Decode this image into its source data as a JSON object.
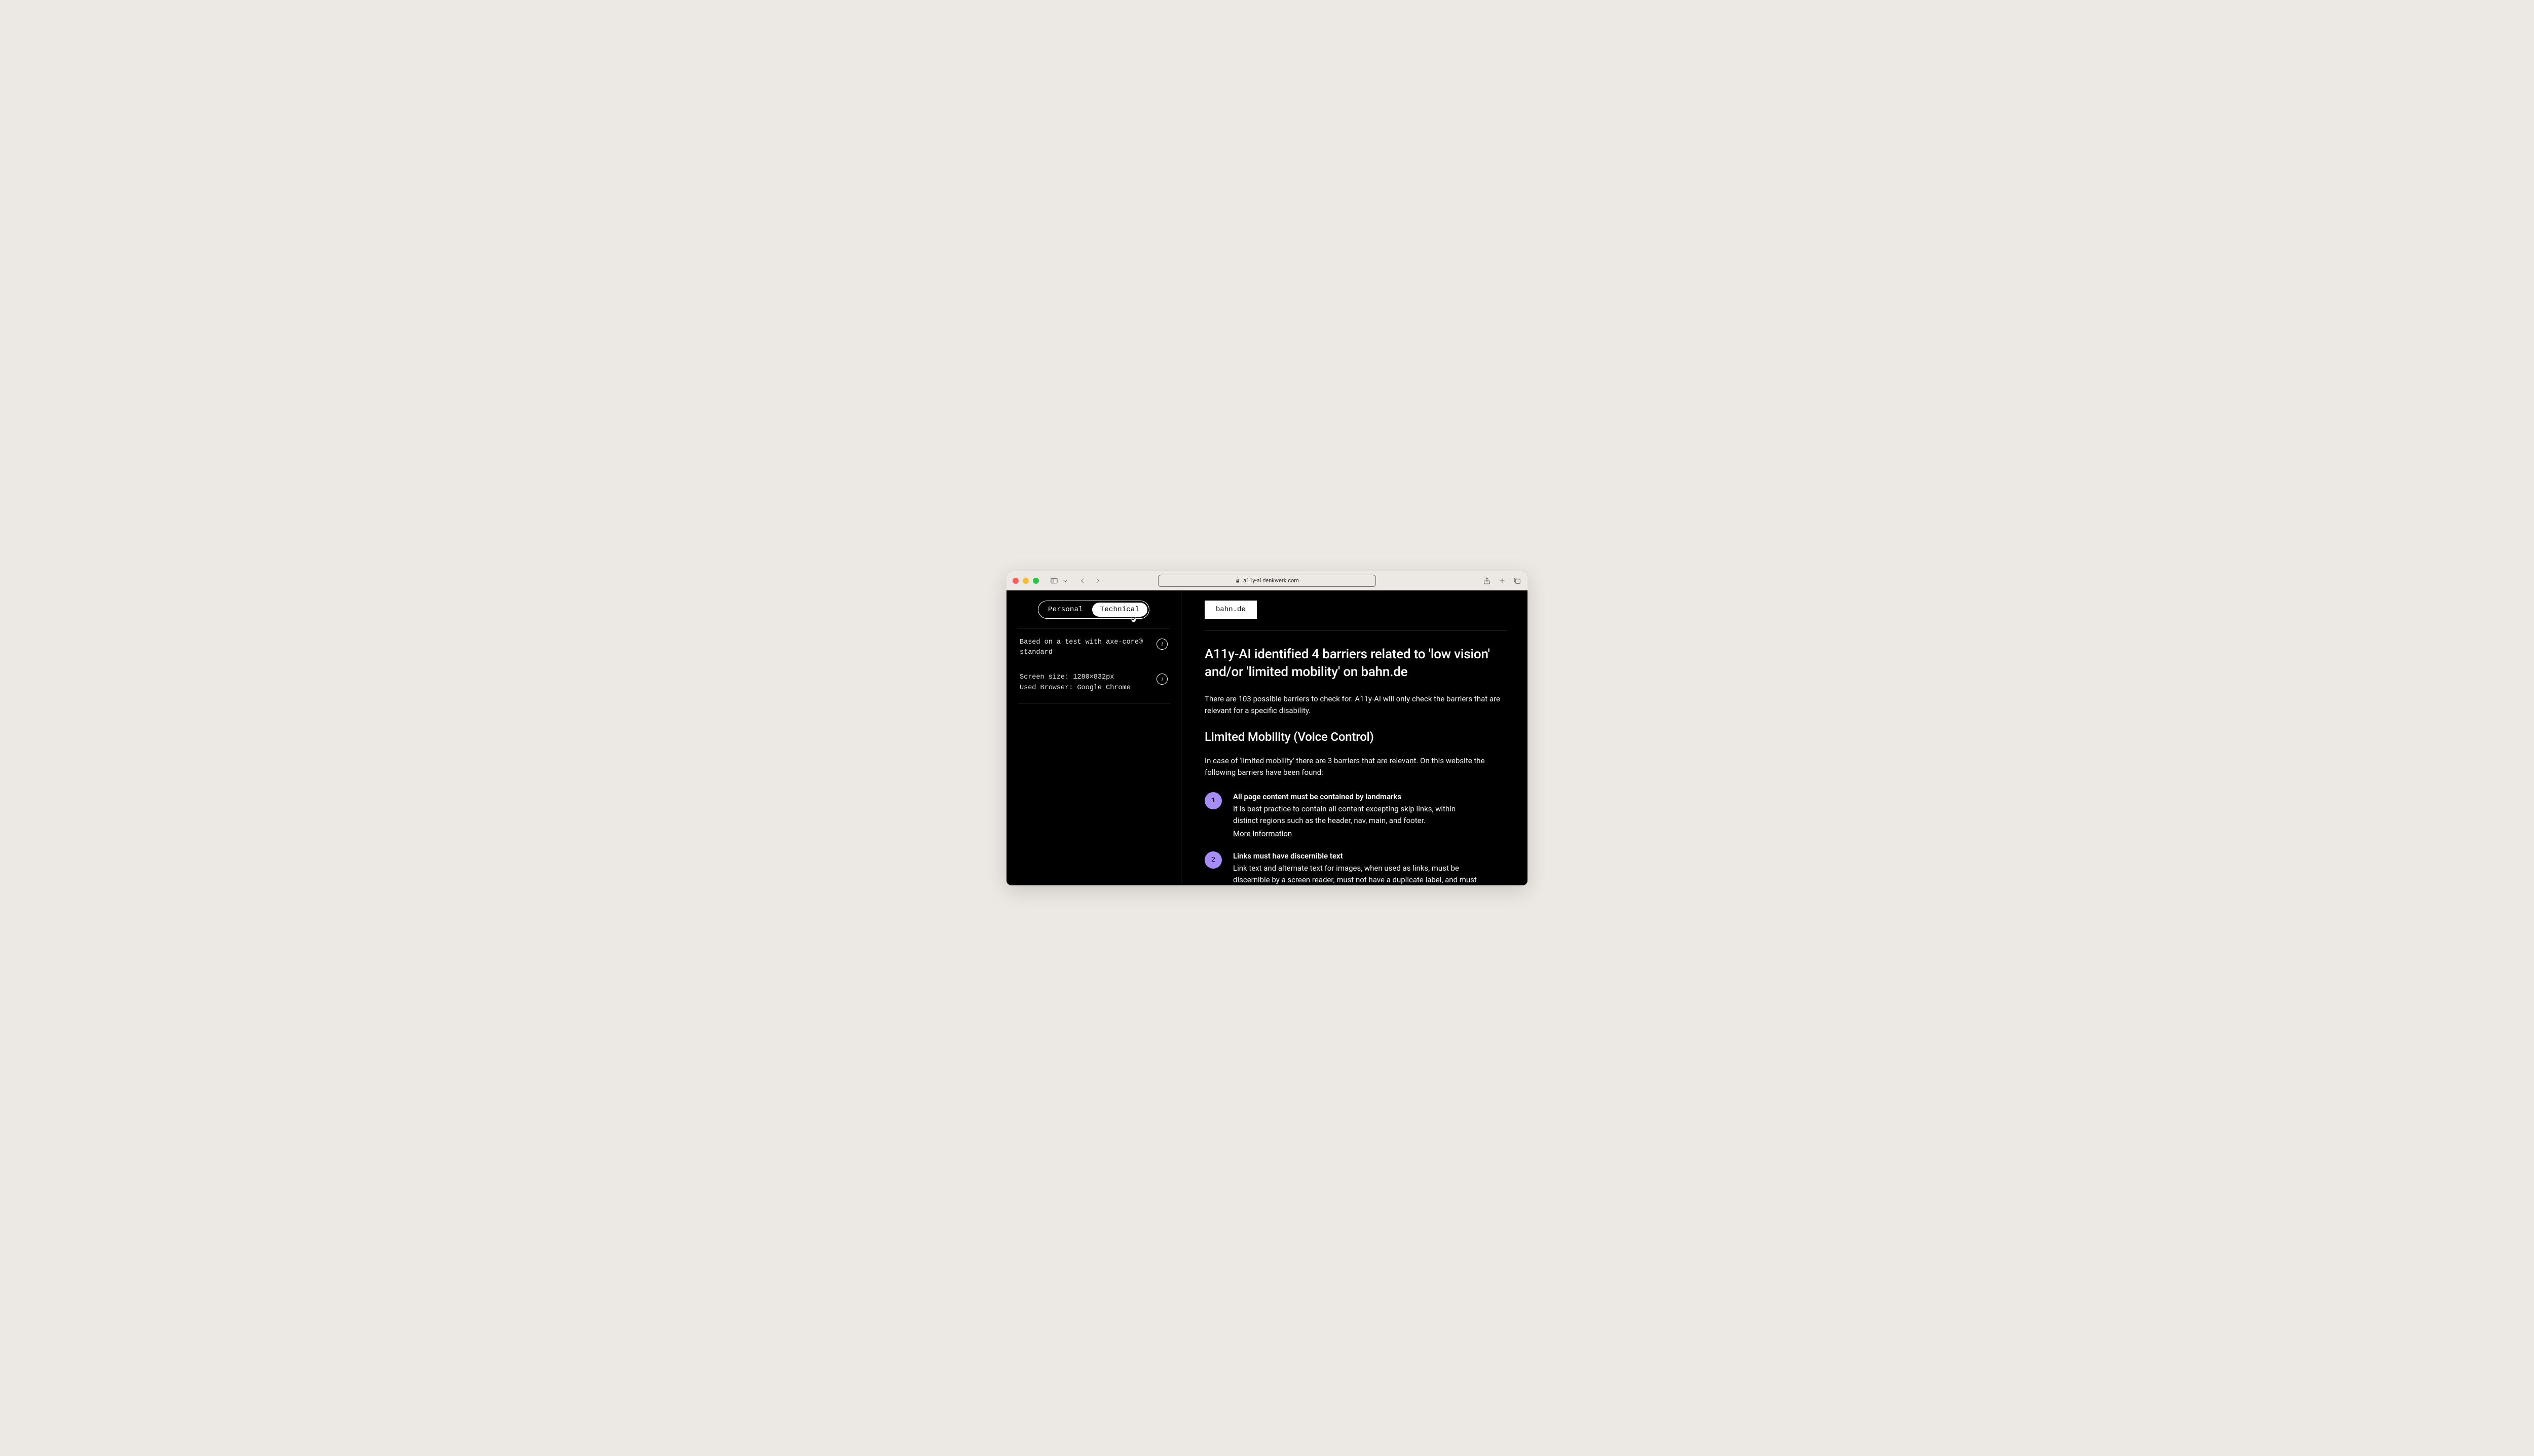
{
  "browser": {
    "url_display": "a11y-ai.denkwerk.com"
  },
  "sidebar": {
    "tabs": {
      "personal": "Personal",
      "technical": "Technical",
      "active": "technical"
    },
    "test_basis": "Based on a test with axe-core® standard",
    "env_line1": "Screen size: 1280×832px",
    "env_line2": "Used Browser: Google Chrome"
  },
  "main": {
    "site_label": "bahn.de",
    "headline": "A11y-AI identified 4 barriers related to 'low vision' and/or 'limited mobility' on bahn.de",
    "intro": "There are 103 possible barriers to check for. A11y-AI will only check the barriers that are relevant for a specific disability.",
    "section_title": "Limited Mobility (Voice Control)",
    "section_intro": "In case of 'limited mobility' there are 3 barriers that are relevant. On this website the following barriers have been found:",
    "more_info_label": "More Information",
    "barriers": [
      {
        "n": "1",
        "title": "All page content must be contained by landmarks",
        "desc": "It is best practice to contain all content excepting skip links, within distinct regions such as the header, nav, main, and footer.",
        "has_link": true
      },
      {
        "n": "2",
        "title": "Links must have discernible text",
        "desc": "Link text and alternate text for images, when used as links, must be discernible by a screen reader, must not have a duplicate label, and must be focusable.",
        "has_link": false
      }
    ]
  }
}
